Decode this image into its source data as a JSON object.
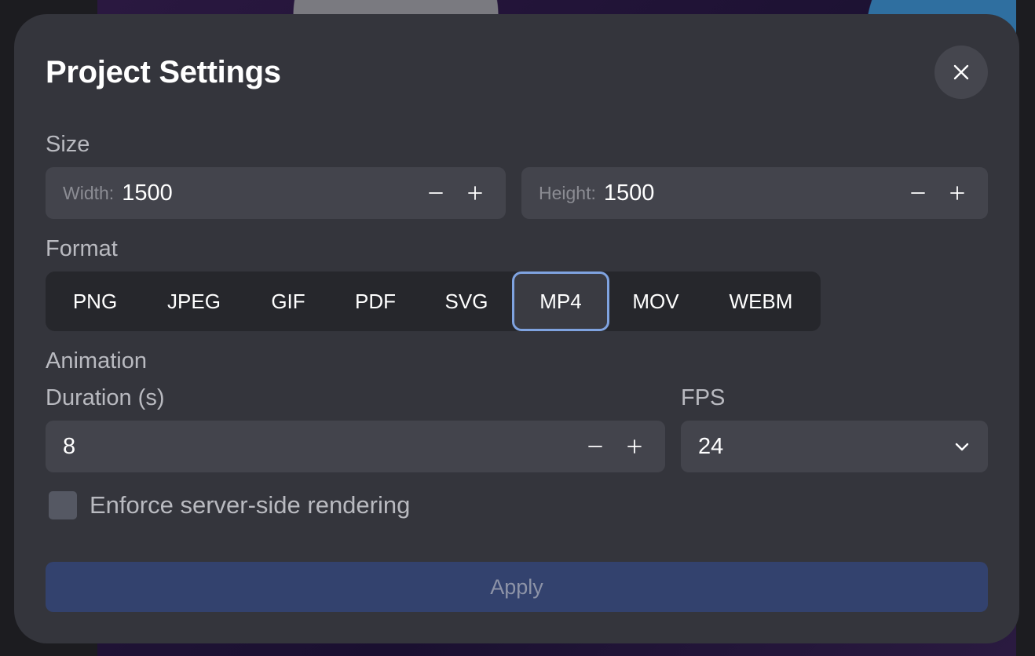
{
  "modal": {
    "title": "Project Settings"
  },
  "size": {
    "label": "Size",
    "width_prefix": "Width:",
    "width_value": "1500",
    "height_prefix": "Height:",
    "height_value": "1500"
  },
  "format": {
    "label": "Format",
    "options": [
      "PNG",
      "JPEG",
      "GIF",
      "PDF",
      "SVG",
      "MP4",
      "MOV",
      "WEBM"
    ],
    "selected": "MP4"
  },
  "animation": {
    "label": "Animation",
    "duration_label": "Duration (s)",
    "duration_value": "8",
    "fps_label": "FPS",
    "fps_value": "24"
  },
  "server_render": {
    "label": "Enforce server-side rendering",
    "checked": false
  },
  "apply_label": "Apply",
  "colors": {
    "modal_bg": "#34353c",
    "field_bg": "#43444c",
    "selected_border": "#7fa3e0",
    "apply_bg": "#33426e"
  },
  "icons": {
    "close": "close-icon",
    "minus": "minus-icon",
    "plus": "plus-icon",
    "chevron": "chevron-down-icon"
  }
}
